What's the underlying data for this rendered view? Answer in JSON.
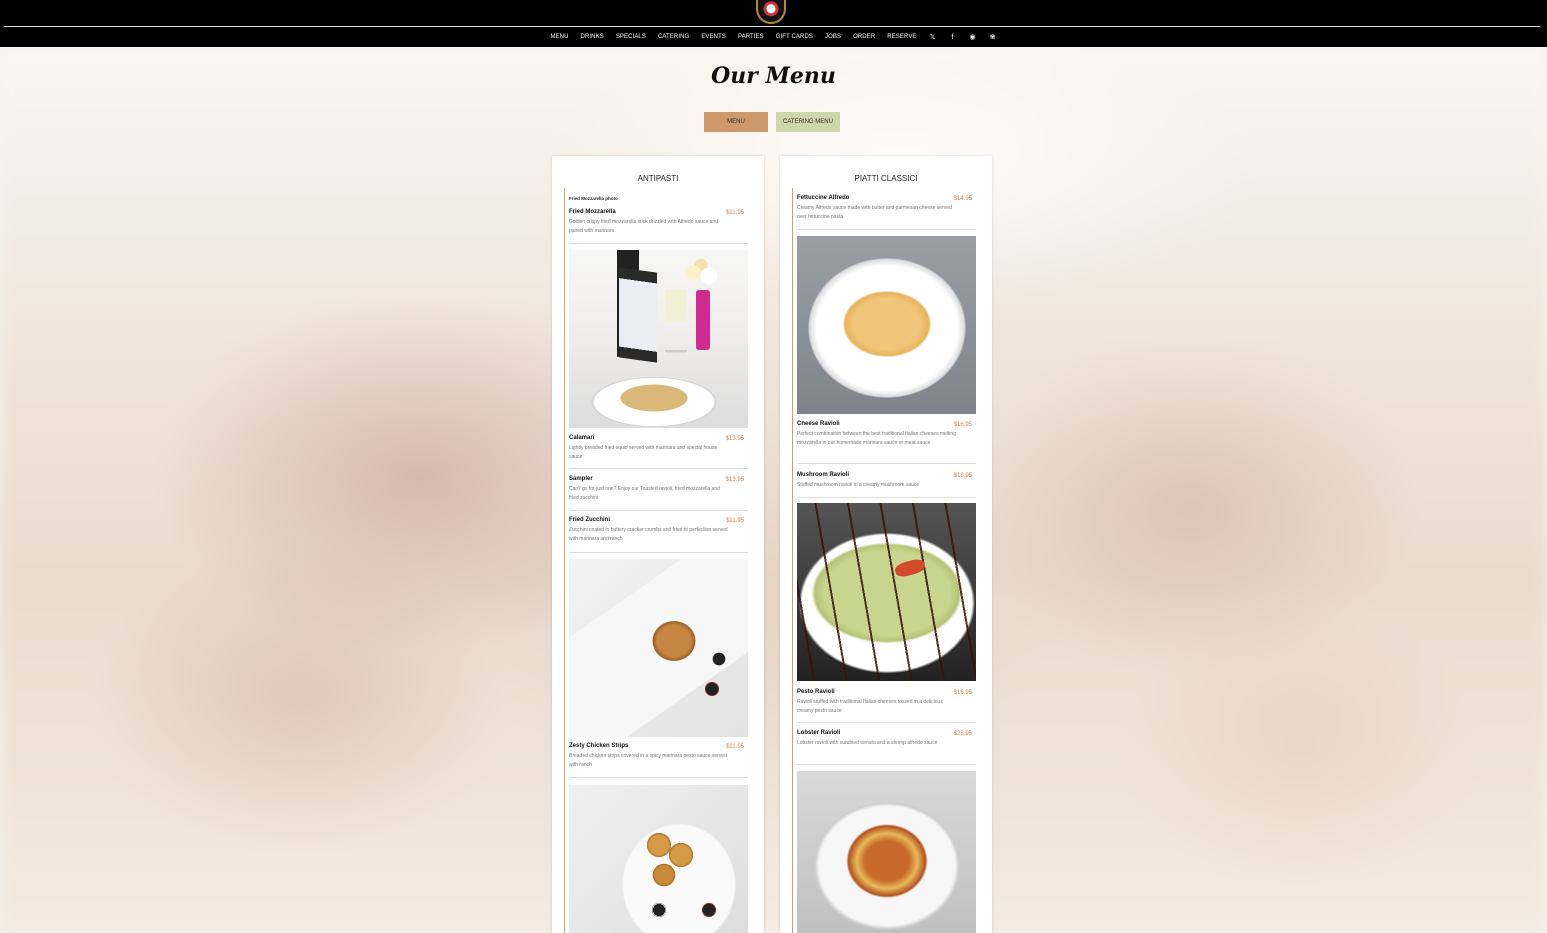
{
  "nav": {
    "items": [
      "MENU",
      "DRINKS",
      "SPECIALS",
      "CATERING",
      "EVENTS",
      "PARTIES",
      "GIFT CARDS",
      "JOBS",
      "ORDER",
      "RESERVE"
    ],
    "social": [
      "twitter-icon",
      "facebook-icon",
      "instagram-icon",
      "yelp-icon"
    ]
  },
  "page_title": "Our Menu",
  "tabs": {
    "menu": "MENU",
    "catering": "CATERING MENU"
  },
  "colors": {
    "header_bg": "#000000",
    "tab_menu": "#cc9a6a",
    "tab_catering": "#cdd7a9",
    "price": "#c8884f"
  },
  "antipasti": {
    "title": "ANTIPASTI",
    "photo_caption": "Fried Mozzarella photo",
    "items": [
      {
        "name": "Fried Mozzarella",
        "price": "$11.95",
        "desc": "Golden crispy fried mozzarella stick drizzled with Alfredo sauce and paired with marinara"
      },
      {
        "name": "Calamari",
        "price": "$13.95",
        "desc": "Lightly breaded fried squid served with marinara and special house sauce"
      },
      {
        "name": "Sampler",
        "price": "$13.95",
        "desc": "Can't go for just one? Enjoy our Toasted ravioli, fried mozzarella and fried zucchini"
      },
      {
        "name": "Fried Zucchini",
        "price": "$11.95",
        "desc": "Zucchini coated in buttery cracker crumbs and fried to perfection served with marinara and ranch"
      },
      {
        "name": "Zesty Chicken Strips",
        "price": "$11.95",
        "desc": "Breaded chicken strips covered in a spicy marinara pesto sauce served with ranch"
      }
    ]
  },
  "piatti_classici": {
    "title": "PIATTI CLASSICI",
    "items": [
      {
        "name": "Fettuccine Alfredo",
        "price": "$14.95",
        "desc": "Creamy Alfredo sauce made with butter and parmesan cheese served over fettuccine pasta"
      },
      {
        "name": "Cheese Ravioli",
        "price": "$16.95",
        "desc": "Perfect combination between the best traditional Italian cheeses melting mozzarella in our homemade marinara sauce or meat sauce"
      },
      {
        "name": "Mushroom Ravioli",
        "price": "$18.95",
        "desc": "Stuffed mushroom ravioli in a creamy mushroom sauce"
      },
      {
        "name": "Pesto Ravioli",
        "price": "$16.95",
        "desc": "Ravioli stuffed with traditional Italian cheeses tossed in a delicious creamy pesto sauce"
      },
      {
        "name": "Lobster Ravioli",
        "price": "$28.95",
        "desc": "Lobster ravioli with sundried tomato and a shrimp alfredo sauce"
      }
    ]
  }
}
